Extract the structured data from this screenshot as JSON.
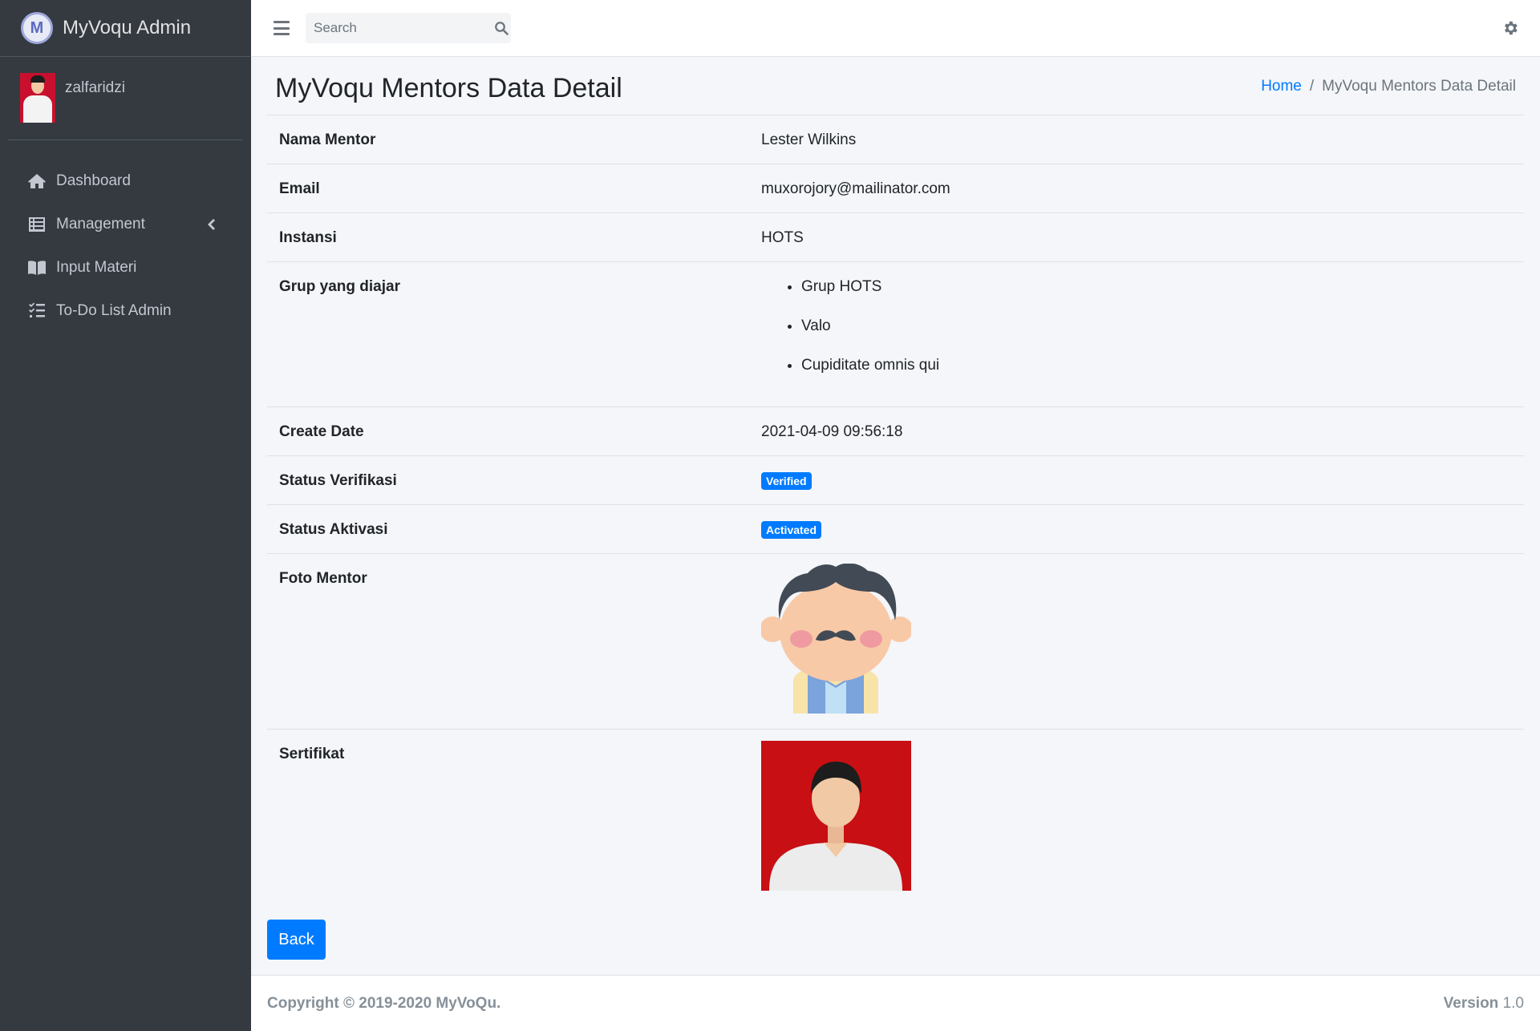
{
  "brand": {
    "logo_letter": "M",
    "name": "MyVoqu Admin"
  },
  "user": {
    "name": "zalfaridzi"
  },
  "sidebar": {
    "items": [
      {
        "label": "Dashboard",
        "icon": "home-icon"
      },
      {
        "label": "Management",
        "icon": "list-icon",
        "has_submenu": true
      },
      {
        "label": "Input Materi",
        "icon": "book-icon"
      },
      {
        "label": "To-Do List Admin",
        "icon": "tasks-icon"
      }
    ]
  },
  "header": {
    "search_placeholder": "Search"
  },
  "page": {
    "title": "MyVoqu Mentors Data Detail",
    "breadcrumb": {
      "home": "Home",
      "separator": "/",
      "current": "MyVoqu Mentors Data Detail"
    }
  },
  "detail": {
    "nama_mentor_label": "Nama Mentor",
    "nama_mentor": "Lester Wilkins",
    "email_label": "Email",
    "email": "muxorojory@mailinator.com",
    "instansi_label": "Instansi",
    "instansi": "HOTS",
    "grup_label": "Grup yang diajar",
    "grup": [
      "Grup HOTS",
      "Valo",
      "Cupiditate omnis qui"
    ],
    "create_date_label": "Create Date",
    "create_date": "2021-04-09 09:56:18",
    "status_verifikasi_label": "Status Verifikasi",
    "status_verifikasi": "Verified",
    "status_aktivasi_label": "Status Aktivasi",
    "status_aktivasi": "Activated",
    "foto_label": "Foto Mentor",
    "sertifikat_label": "Sertifikat"
  },
  "actions": {
    "back_label": "Back"
  },
  "footer": {
    "copyright": "Copyright © 2019-2020 MyVoQu.",
    "version_label": "Version",
    "version": "1.0"
  },
  "colors": {
    "primary": "#007bff",
    "sidebar": "#343a40"
  }
}
